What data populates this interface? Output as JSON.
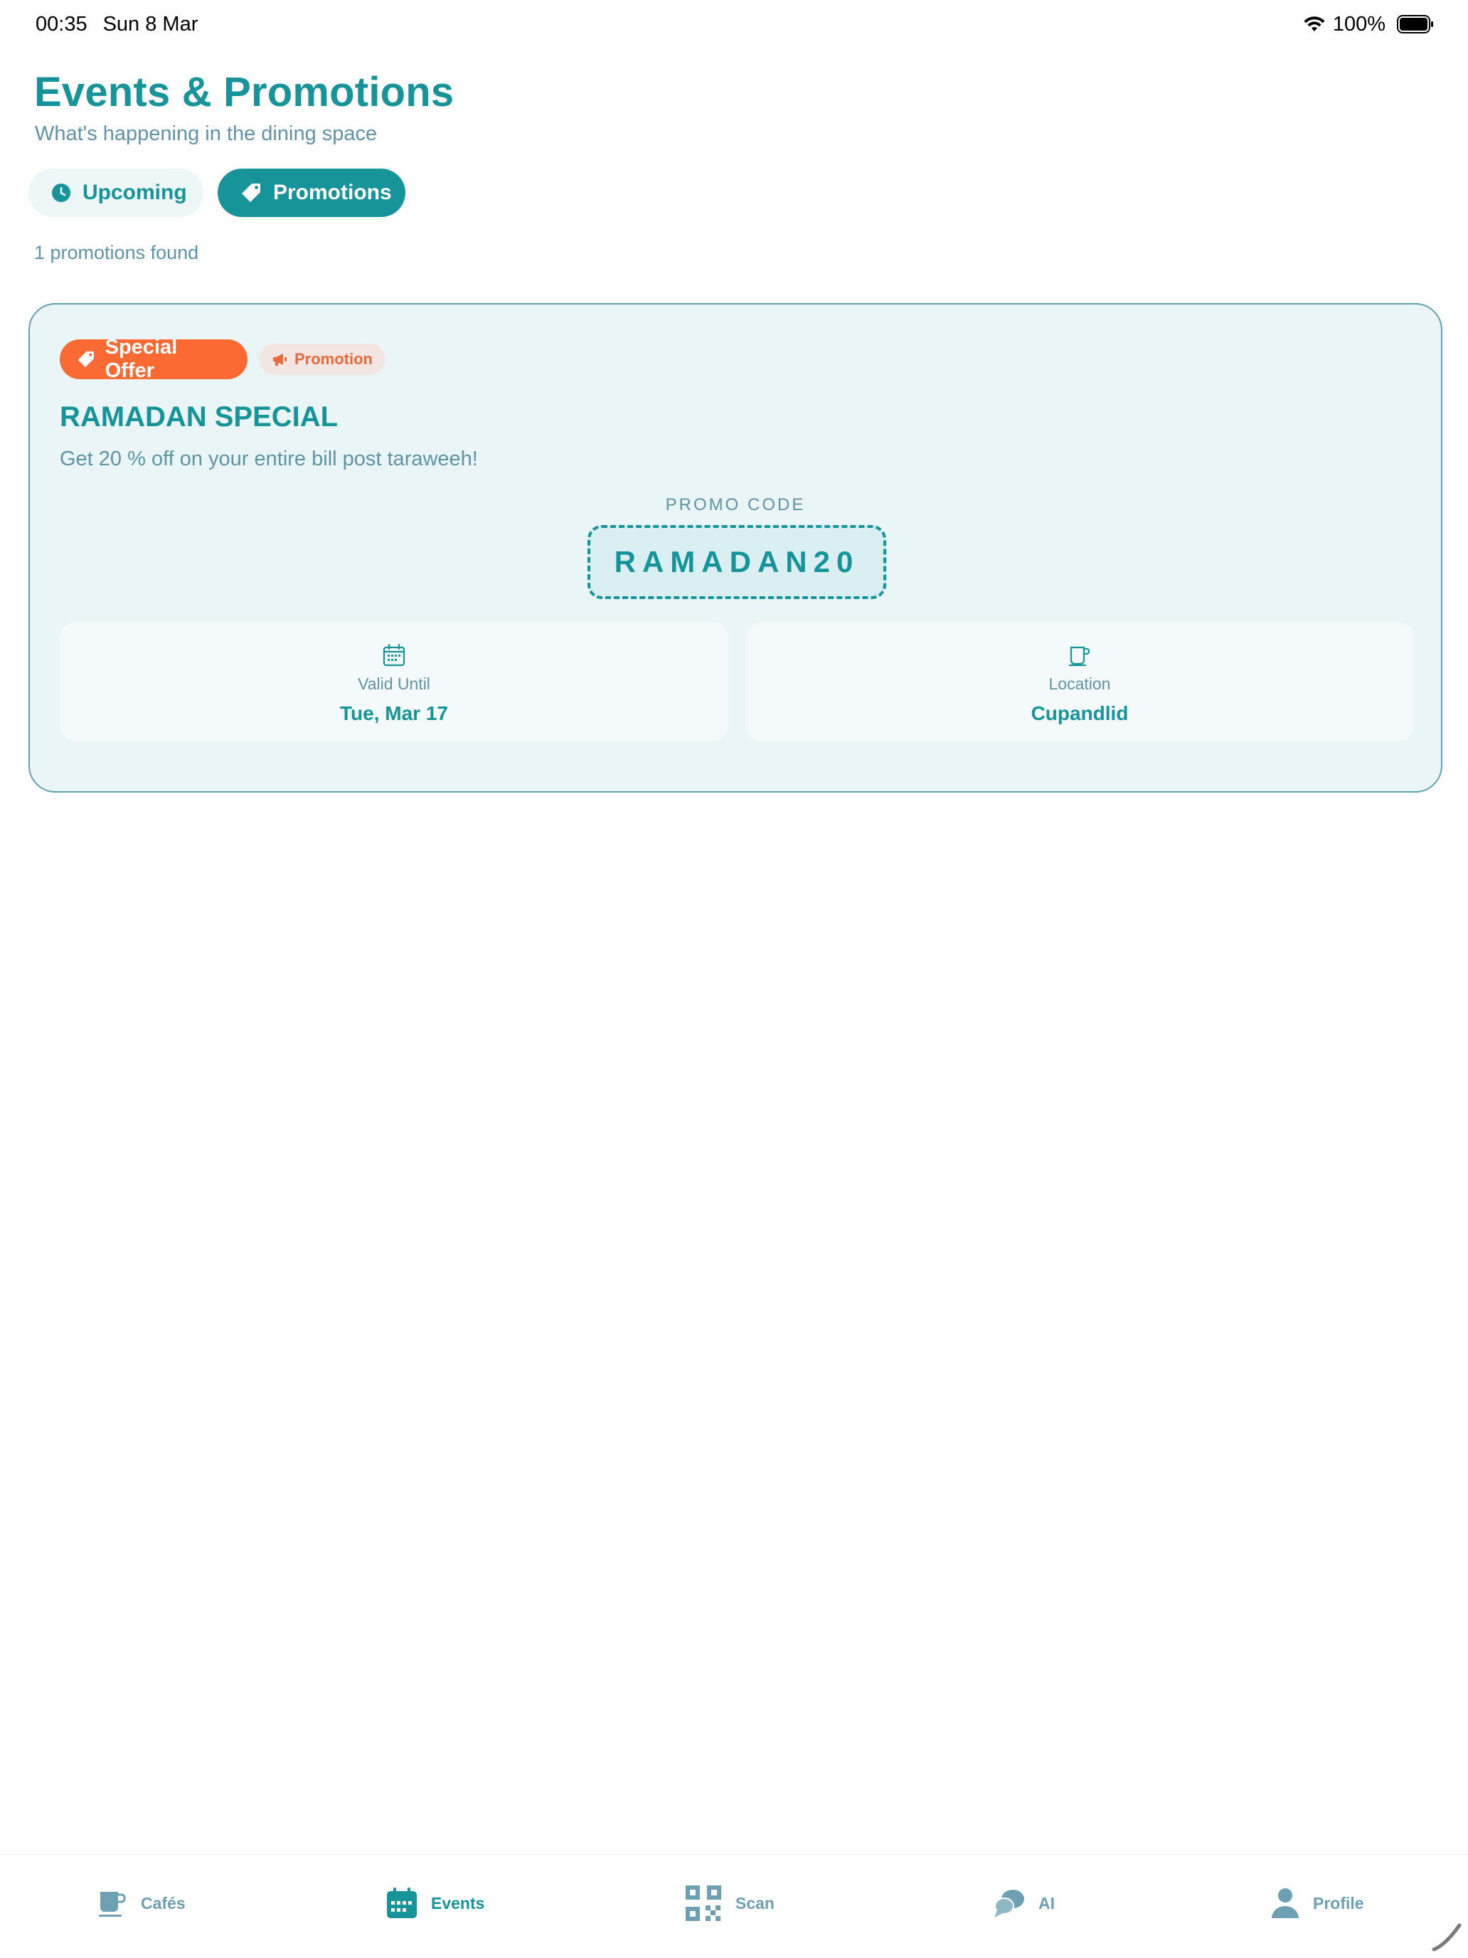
{
  "status_bar": {
    "time": "00:35",
    "date": "Sun 8 Mar",
    "battery": "100%"
  },
  "header": {
    "title": "Events & Promotions",
    "subtitle": "What's happening in the dining space"
  },
  "tabs": [
    {
      "label": "Upcoming",
      "icon": "clock-icon",
      "active": false
    },
    {
      "label": "Promotions",
      "icon": "tag-icon",
      "active": true
    }
  ],
  "result_count": "1 promotions found",
  "promotion": {
    "badge_offer": "Special Offer",
    "badge_type": "Promotion",
    "title": "RAMADAN SPECIAL",
    "description": "Get 20 % off on your entire bill post taraweeh!",
    "promo_code_label": "PROMO CODE",
    "promo_code": "RAMADAN20",
    "valid_until_label": "Valid Until",
    "valid_until": "Tue, Mar 17",
    "location_label": "Location",
    "location": "Cupandlid"
  },
  "bottom_nav": [
    {
      "label": "Cafés",
      "icon": "coffee-cup-icon",
      "active": false
    },
    {
      "label": "Events",
      "icon": "calendar-icon",
      "active": true
    },
    {
      "label": "Scan",
      "icon": "qr-code-icon",
      "active": false
    },
    {
      "label": "AI",
      "icon": "chat-bubbles-icon",
      "active": false
    },
    {
      "label": "Profile",
      "icon": "user-icon",
      "active": false
    }
  ],
  "colors": {
    "accent": "#17939a",
    "muted": "#5e94a6",
    "offer": "#fa6a32",
    "card_bg": "#eaf5f7"
  }
}
